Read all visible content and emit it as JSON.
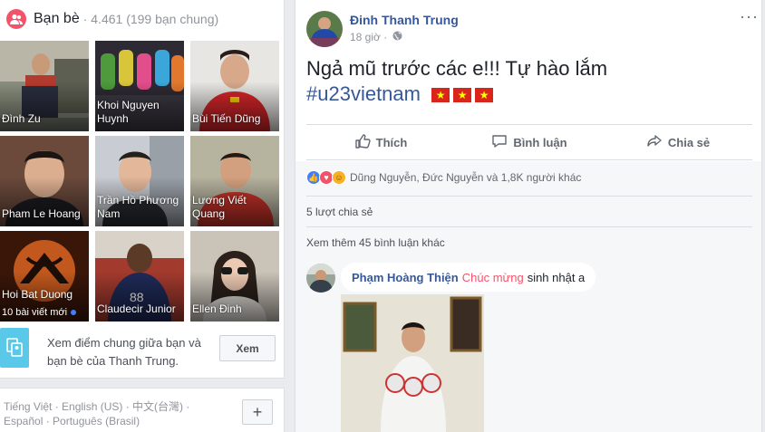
{
  "friends": {
    "title": "Bạn bè",
    "count": "· 4.461 (199 bạn chung)",
    "tiles": [
      {
        "name": "Đình Zu"
      },
      {
        "name": "Khoi Nguyen Huynh"
      },
      {
        "name": "Bùi Tiến Dũng"
      },
      {
        "name": "Pham Le Hoang"
      },
      {
        "name": "Trần Hồ Phương Nam"
      },
      {
        "name": "Lương Viết Quang"
      },
      {
        "name": "Hoi Bat Duong",
        "sub": "10 bài viết mới"
      },
      {
        "name": "Claudecir Junior"
      },
      {
        "name": "Ellen Đinh"
      }
    ],
    "promo_text": "Xem điểm chung giữa bạn và bạn bè của Thanh Trung.",
    "promo_button": "Xem"
  },
  "languages": {
    "line1": "Tiếng Việt · English (US) · 中文(台灣) ·",
    "line2": "Español · Português (Brasil)",
    "add_label": "+"
  },
  "post": {
    "author": "Đinh Thanh Trung",
    "time": "18 giờ ·",
    "more": "···",
    "text": "Ngả mũ trước các e!!! Tự hào lắm",
    "hashtag": "#u23vietnam",
    "flag_glyph": "★",
    "actions": {
      "like": "Thích",
      "comment": "Bình luận",
      "share": "Chia sẻ"
    },
    "reactions_text": "Dũng Nguyễn, Đức Nguyễn và 1,8K người khác",
    "shares_text": "5 lượt chia sẻ",
    "more_comments": "Xem thêm 45 bình luận khác",
    "comment": {
      "author": "Phạm Hoàng Thiện",
      "highlight": "Chúc mừng",
      "text": "sinh nhật a"
    }
  },
  "colors": {
    "brand_blue": "#365899",
    "friends_icon": "#f35369",
    "flag_red": "#da251d",
    "flag_star": "#ffff00"
  }
}
